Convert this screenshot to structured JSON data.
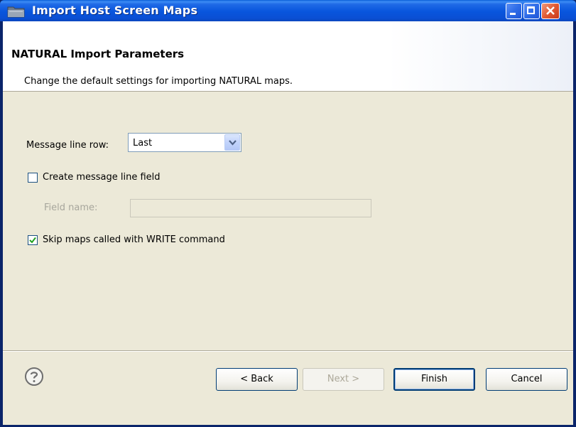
{
  "window": {
    "title": "Import Host Screen Maps"
  },
  "header": {
    "title": "NATURAL Import Parameters",
    "description": "Change the default settings for importing NATURAL maps."
  },
  "form": {
    "message_line_row_label": "Message line row:",
    "message_line_row_value": "Last",
    "create_message_line_label": "Create message line field",
    "create_message_line_checked": false,
    "field_name_label": "Field name:",
    "field_name_value": "",
    "skip_maps_label": "Skip maps called with WRITE command",
    "skip_maps_checked": true
  },
  "footer": {
    "back_label": "< Back",
    "next_label": "Next >",
    "finish_label": "Finish",
    "cancel_label": "Cancel"
  },
  "colors": {
    "titlebar": "#0855dd",
    "dialog_bg": "#ece9d8",
    "checkmark": "#21a121"
  }
}
